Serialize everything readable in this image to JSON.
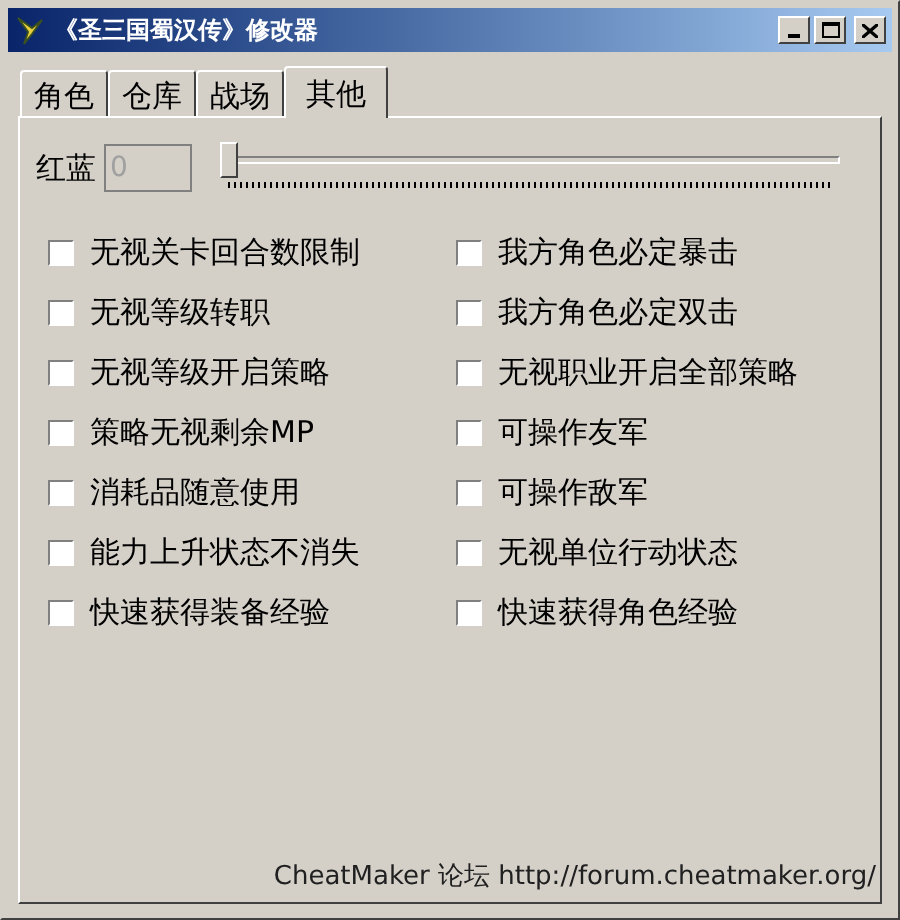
{
  "window": {
    "title": "《圣三国蜀汉传》修改器"
  },
  "tabs": [
    {
      "label": "角色",
      "selected": false
    },
    {
      "label": "仓库",
      "selected": false
    },
    {
      "label": "战场",
      "selected": false
    },
    {
      "label": "其他",
      "selected": true
    }
  ],
  "slider_row": {
    "label": "红蓝",
    "value": "0",
    "disabled": true,
    "level": 0
  },
  "options": [
    {
      "label": "无视关卡回合数限制",
      "checked": false
    },
    {
      "label": "我方角色必定暴击",
      "checked": false
    },
    {
      "label": "无视等级转职",
      "checked": false
    },
    {
      "label": "我方角色必定双击",
      "checked": false
    },
    {
      "label": "无视等级开启策略",
      "checked": false
    },
    {
      "label": "无视职业开启全部策略",
      "checked": false
    },
    {
      "label": "策略无视剩余MP",
      "checked": false
    },
    {
      "label": "可操作友军",
      "checked": false
    },
    {
      "label": "消耗品随意使用",
      "checked": false
    },
    {
      "label": "可操作敌军",
      "checked": false
    },
    {
      "label": "能力上升状态不消失",
      "checked": false
    },
    {
      "label": "无视单位行动状态",
      "checked": false
    },
    {
      "label": "快速获得装备经验",
      "checked": false
    },
    {
      "label": "快速获得角色经验",
      "checked": false
    }
  ],
  "footer": "CheatMaker 论坛 http://forum.cheatmaker.org/"
}
